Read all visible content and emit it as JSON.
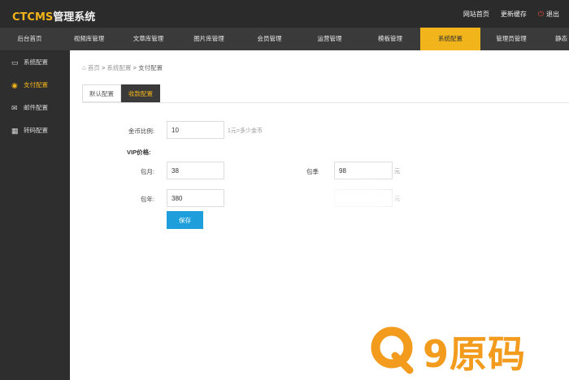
{
  "header": {
    "logo_prefix": "CTCMS",
    "logo_suffix": "管理系统",
    "links": [
      "网站首页",
      "更新缓存"
    ],
    "exit": "退出"
  },
  "nav": {
    "items": [
      "后台首页",
      "视频库管理",
      "文章库管理",
      "图片库管理",
      "会员管理",
      "运营管理",
      "模板管理",
      "系统配置",
      "管理员管理",
      "静态"
    ],
    "active": "系统配置"
  },
  "sidebar": {
    "items": [
      "系统配置",
      "支付配置",
      "邮件配置",
      "转码配置"
    ],
    "active": "支付配置"
  },
  "breadcrumb": {
    "home": "首页",
    "sep1": ">",
    "section": "系统配置",
    "sep2": ">",
    "current": "支付配置"
  },
  "tabs": {
    "items": [
      "默认配置",
      "收款配置"
    ],
    "active": "收款配置"
  },
  "form": {
    "coin_label": "金币比例:",
    "coin_value": "10",
    "coin_hint": "1元=多少金币",
    "vip_title": "VIP价格:",
    "month_label": "包月:",
    "month_value": "38",
    "quarter_label": "包季",
    "quarter_value": "98",
    "quarter_unit": "元",
    "year_label": "包年:",
    "year_value": "380",
    "halfyear_value": "",
    "halfyear_unit": "元",
    "save": "保存"
  },
  "watermark": {
    "text": "9原码"
  },
  "colors": {
    "accent": "#f2b41b",
    "topbar": "#2b2b2b",
    "navbar": "#3a3a3a",
    "sidebar": "#2e2e2e",
    "button": "#1e9fdb",
    "watermark": "#f29b1d"
  }
}
